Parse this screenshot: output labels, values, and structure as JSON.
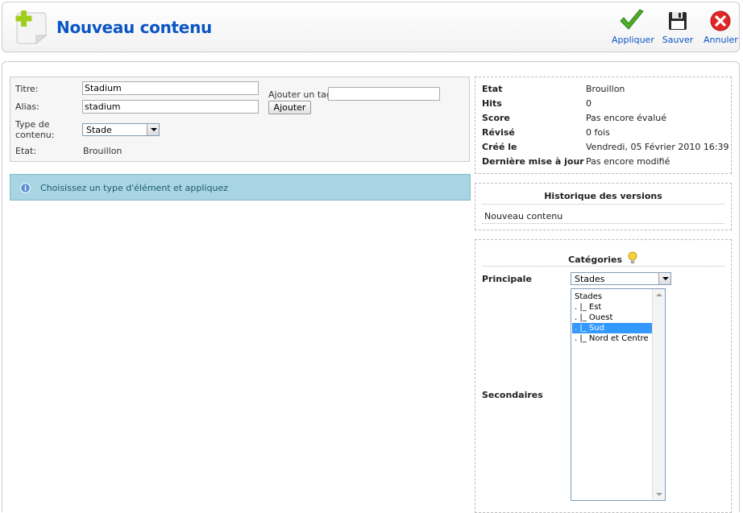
{
  "toolbar": {
    "title": "Nouveau contenu",
    "apply_label": "Appliquer",
    "save_label": "Sauver",
    "cancel_label": "Annuler"
  },
  "form": {
    "title_label": "Titre:",
    "title_value": "Stadium",
    "alias_label": "Alias:",
    "alias_value": "stadium",
    "type_label_line1": "Type de",
    "type_label_line2": "contenu:",
    "type_value": "Stade",
    "state_label": "Etat:",
    "state_value": "Brouillon",
    "tag_label": "Ajouter un tag:",
    "tag_value": "",
    "tag_button": "Ajouter"
  },
  "info": {
    "message": "Choisissez un type d'élément et appliquez"
  },
  "meta": {
    "rows": [
      {
        "key": "Etat",
        "value": "Brouillon"
      },
      {
        "key": "Hits",
        "value": "0"
      },
      {
        "key": "Score",
        "value": "Pas encore évalué"
      },
      {
        "key": "Révisé",
        "value": "0 fois"
      },
      {
        "key": "Créé le",
        "value": "Vendredi, 05 Février 2010 16:39"
      },
      {
        "key": "Dernière mise à jour",
        "value": "Pas encore modifié"
      }
    ]
  },
  "versions": {
    "title": "Historique des versions",
    "entry": "Nouveau contenu"
  },
  "categories": {
    "title": "Catégories",
    "primary_label": "Principale",
    "primary_value": "Stades",
    "secondary_label": "Secondaires",
    "items": [
      "Stades",
      ".     |_ Est",
      ".     |_ Ouest",
      ".     |_ Sud",
      ".     |_ Nord et Centre"
    ],
    "selected_index": 3
  },
  "colors": {
    "accent": "#0b55c4",
    "info_bg": "#a9d4e2",
    "selection": "#3399ff"
  },
  "icons": {
    "page": "add-document-icon",
    "apply": "checkmark-icon",
    "save": "floppy-disk-icon",
    "cancel": "cancel-x-icon",
    "info": "info-icon",
    "help": "lightbulb-icon"
  }
}
